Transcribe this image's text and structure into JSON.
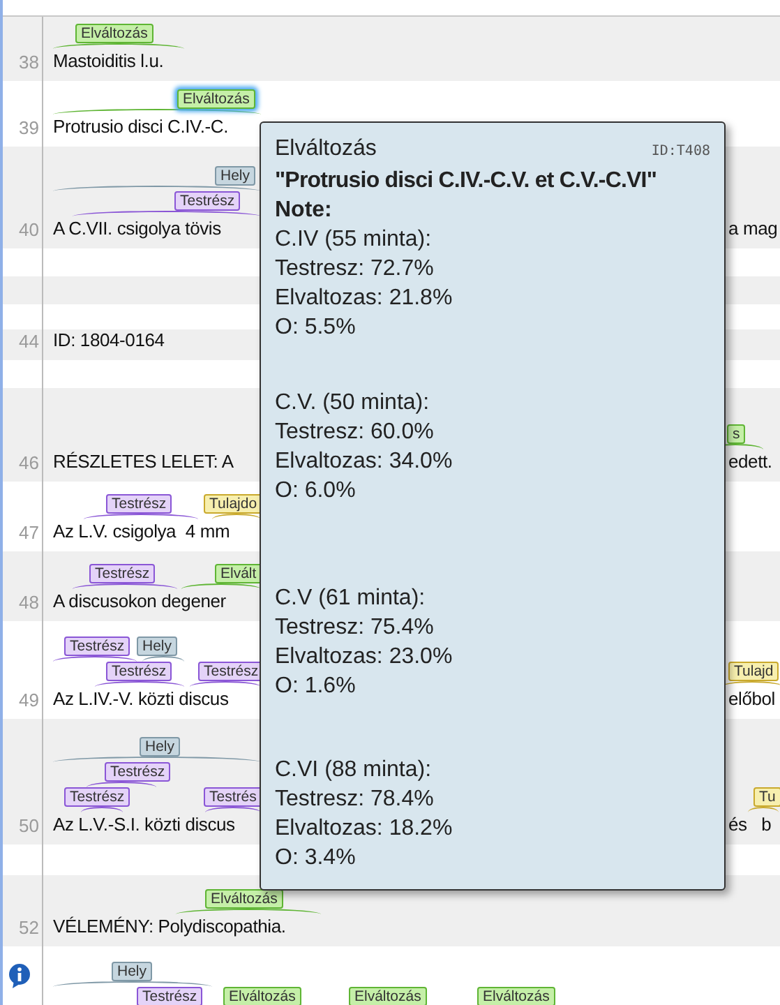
{
  "rows": [
    {
      "number": "38",
      "text": "Mastoiditis l.u.",
      "tiers": [
        [
          {
            "text": "Elváltozás",
            "kind": "elvaltozas",
            "selected": false
          }
        ]
      ]
    },
    {
      "number": "39",
      "text": "Protrusio disci C.IV.-C.",
      "tiers": [
        [
          {
            "text": "Elváltozás",
            "kind": "elvaltozas",
            "selected": true
          }
        ]
      ]
    },
    {
      "number": "40",
      "text": "A C.VII. csigolya tövis",
      "right_text": "a mag",
      "tiers": [
        [
          {
            "text": "Hely",
            "kind": "hely",
            "selected": false
          }
        ],
        [
          {
            "text": "Testrész",
            "kind": "testresz",
            "selected": false
          }
        ]
      ]
    },
    {
      "number": "44",
      "text": "ID: 1804-0164",
      "tiers": []
    },
    {
      "number": "46",
      "text": "RÉSZLETES LELET: A",
      "right_text": "edett.",
      "tiers": [
        [
          {
            "text": "s",
            "kind": "elvaltozas",
            "selected": false
          }
        ]
      ]
    },
    {
      "number": "47",
      "text": "Az L.V. csigolya  4 mm",
      "tiers": [
        [
          {
            "text": "Testrész",
            "kind": "testresz",
            "selected": false
          },
          {
            "text": "Tulajdo",
            "kind": "tulajdonsag",
            "selected": false
          }
        ]
      ]
    },
    {
      "number": "48",
      "text": "A discusokon degener",
      "tiers": [
        [
          {
            "text": "Testrész",
            "kind": "testresz",
            "selected": false
          },
          {
            "text": "Elvált",
            "kind": "elvaltozas",
            "selected": false
          }
        ]
      ]
    },
    {
      "number": "49",
      "text": "Az L.IV.-V. közti discus",
      "right_text": "előbol",
      "tiers": [
        [
          {
            "text": "Testrész",
            "kind": "testresz",
            "selected": false
          },
          {
            "text": "Hely",
            "kind": "hely",
            "selected": false
          }
        ],
        [
          {
            "text": "Testrész",
            "kind": "testresz",
            "selected": false
          },
          {
            "text": "Testrész",
            "kind": "testresz",
            "selected": false
          },
          {
            "text": "Tulajd",
            "kind": "tulajdonsag",
            "selected": false
          }
        ]
      ]
    },
    {
      "number": "50",
      "text": "Az L.V.-S.I. közti discus",
      "right_text": "és   b",
      "tiers": [
        [
          {
            "text": "Hely",
            "kind": "hely",
            "selected": false
          }
        ],
        [
          {
            "text": "Testrész",
            "kind": "testresz",
            "selected": false
          }
        ],
        [
          {
            "text": "Testrész",
            "kind": "testresz",
            "selected": false
          },
          {
            "text": "Testrés",
            "kind": "testresz",
            "selected": false
          },
          {
            "text": "Tu",
            "kind": "tulajdonsag",
            "selected": false
          }
        ]
      ]
    },
    {
      "number": "52",
      "text": "VÉLEMÉNY: Polydiscopathia.",
      "tiers": [
        [
          {
            "text": "Elváltozás",
            "kind": "elvaltozas",
            "selected": false
          }
        ]
      ]
    },
    {
      "info": true,
      "tiers": [
        [
          {
            "text": "Hely",
            "kind": "hely",
            "selected": false
          }
        ],
        [
          {
            "text": "Testrész",
            "kind": "testresz",
            "selected": false
          },
          {
            "text": "Elváltozás",
            "kind": "elvaltozas",
            "selected": false
          },
          {
            "text": "Elváltozás",
            "kind": "elvaltozas",
            "selected": false
          },
          {
            "text": "Elváltozás",
            "kind": "elvaltozas",
            "selected": false
          }
        ]
      ]
    }
  ],
  "tooltip": {
    "type": "Elváltozás",
    "id": "ID:T408",
    "quote": "\"Protrusio disci C.IV.-C.V. et C.V.-C.VI\"",
    "note_label": "Note:",
    "groups": [
      {
        "heading": "C.IV (55 minta):",
        "lines": [
          "Testresz: 72.7%",
          "Elvaltozas: 21.8%",
          "O: 5.5%"
        ]
      },
      {
        "heading": "C.V. (50 minta):",
        "lines": [
          "Testresz: 60.0%",
          "Elvaltozas: 34.0%",
          "O: 6.0%"
        ]
      },
      {
        "heading": "C.V (61 minta):",
        "lines": [
          "Testresz: 75.4%",
          "Elvaltozas: 23.0%",
          "O: 1.6%"
        ]
      },
      {
        "heading": "C.VI (88 minta):",
        "lines": [
          "Testresz: 78.4%",
          "Elvaltozas: 18.2%",
          "O: 3.4%"
        ]
      }
    ]
  }
}
